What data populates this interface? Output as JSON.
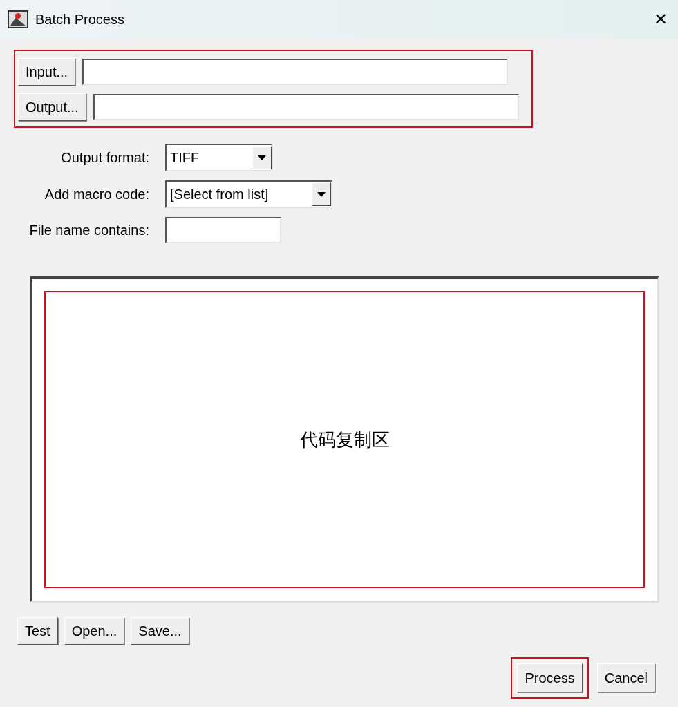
{
  "window": {
    "title": "Batch Process",
    "close": "✕"
  },
  "path_group": {
    "highlighted": true,
    "buttons": [
      {
        "label": "Input..."
      },
      {
        "label": "Output..."
      }
    ]
  },
  "options": [
    {
      "label": "Output format:",
      "kind": "dropdown",
      "value": "TIFF"
    },
    {
      "label": "Add macro code:",
      "kind": "dropdown",
      "value": "[Select from list]"
    },
    {
      "label": "File name contains:",
      "kind": "text"
    }
  ],
  "code_area": {
    "note": "代码复制区",
    "highlighted": true
  },
  "macro_buttons": [
    "Test",
    "Open...",
    "Save..."
  ],
  "actions": [
    {
      "label": "Process",
      "highlighted": true
    },
    {
      "label": "Cancel"
    }
  ]
}
